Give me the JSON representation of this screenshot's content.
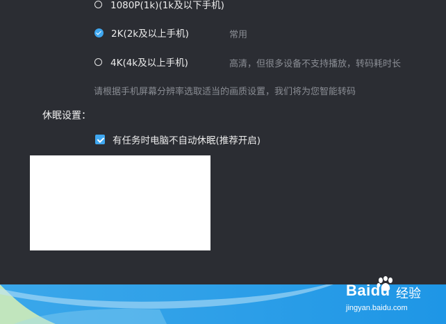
{
  "resolution": {
    "options": [
      {
        "label": "1080P(1k)(1k及以下手机)",
        "note": "",
        "checked": false
      },
      {
        "label": "2K(2k及以上手机)",
        "note": "常用",
        "checked": true
      },
      {
        "label": "4K(4k及以上手机)",
        "note": "高清，但很多设备不支持播放，转码耗时长",
        "checked": false
      }
    ],
    "hint": "请根据手机屏幕分辨率选取适当的画质设置，我们将为您智能转码"
  },
  "sleep": {
    "title": "休眠设置：",
    "checkbox_label": "有任务时电脑不自动休眠(推荐开启)",
    "checked": true
  },
  "watermark": {
    "brand": "Baidu",
    "cn": "经验",
    "url": "jingyan.baidu.com"
  },
  "colors": {
    "accent": "#3fa7f0",
    "background": "#2b2d33"
  }
}
